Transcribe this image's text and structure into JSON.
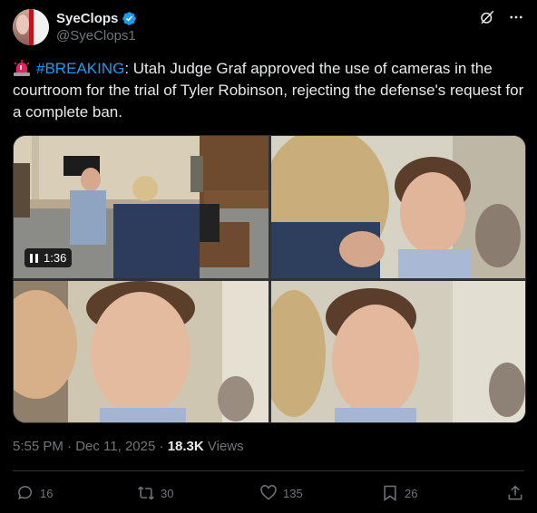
{
  "author": {
    "display_name": "SyeClops",
    "handle": "@SyeClops1",
    "verified": true,
    "avatar_icon": "avatar-image"
  },
  "header_icons": [
    "grok-icon",
    "more-icon"
  ],
  "tweet": {
    "hashtag": "#BREAKING",
    "body": ": Utah Judge Graf approved the use of cameras in the courtroom for the trial of Tyler Robinson, rejecting the defense's request for a complete ban.",
    "emoji_icon": "siren-icon"
  },
  "media": {
    "video_duration": "1:36"
  },
  "meta": {
    "time": "5:55 PM",
    "sep1": " · ",
    "date": "Dec 11, 2025",
    "sep2": " · ",
    "views_count": "18.3K",
    "views_label": " Views"
  },
  "actions": {
    "replies": "16",
    "reposts": "30",
    "likes": "135",
    "bookmarks": "26"
  },
  "colors": {
    "background": "#000000",
    "accent": "#1d9bf0",
    "muted": "#71767b",
    "text": "#e7e9ea"
  }
}
